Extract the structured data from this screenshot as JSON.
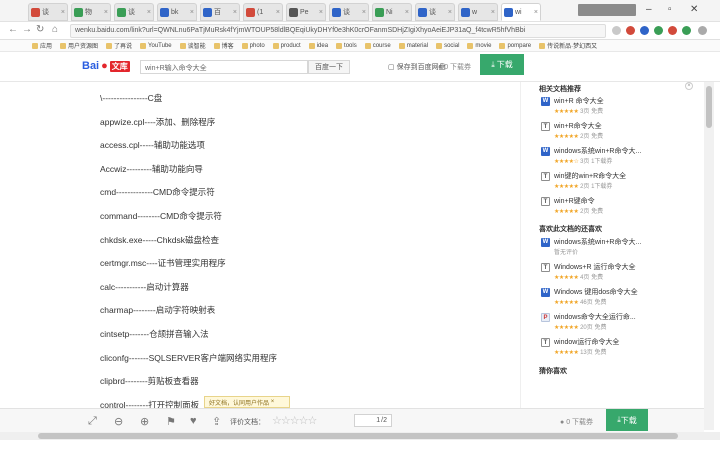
{
  "browser": {
    "tabs": [
      {
        "label": "谈",
        "color": "#d24a3b",
        "active": false
      },
      {
        "label": "物",
        "color": "#3a9e56",
        "active": false
      },
      {
        "label": "谈",
        "color": "#3a9e56",
        "active": false
      },
      {
        "label": "bk",
        "color": "#2f64c8",
        "active": false
      },
      {
        "label": "百",
        "color": "#2f64c8",
        "active": false
      },
      {
        "label": "(1",
        "color": "#d24a3b",
        "active": false
      },
      {
        "label": "Pe",
        "color": "#555555",
        "active": false
      },
      {
        "label": "谈",
        "color": "#2f64c8",
        "active": false
      },
      {
        "label": "Ni",
        "color": "#3a9e56",
        "active": false
      },
      {
        "label": "谈",
        "color": "#2f64c8",
        "active": false
      },
      {
        "label": "w",
        "color": "#2f64c8",
        "active": false
      },
      {
        "label": "wi",
        "color": "#2f64c8",
        "active": true
      }
    ],
    "profile_label": "",
    "url": "wenku.baidu.com/link?url=QWNLnu6PaTjMuRsk4fYjmWTOUP58ldlBQEqiUkyDHYf0e3hK0crOFanmSDHjZIgiXhyoAeiEJP31aQ_f4tcwR5hfVhBbi",
    "bookmarks": [
      {
        "label": "应用"
      },
      {
        "label": "用户资源图"
      },
      {
        "label": "了再说"
      },
      {
        "label": "YouTube"
      },
      {
        "label": "谈智能"
      },
      {
        "label": "博客"
      },
      {
        "label": "photo"
      },
      {
        "label": "product"
      },
      {
        "label": "idea"
      },
      {
        "label": "tools"
      },
      {
        "label": "course"
      },
      {
        "label": "material"
      },
      {
        "label": "social"
      },
      {
        "label": "movie"
      },
      {
        "label": "pompare"
      },
      {
        "label": "传说新品·梦幻西又"
      }
    ]
  },
  "wenku": {
    "logo_text": "Bai",
    "logo_badge": "文库",
    "search_value": "win+R输入命令大全",
    "search_button": "百度一下",
    "save_label": "保存到百度网盘",
    "coins": "0 下载券",
    "download_label": "下载"
  },
  "document": {
    "lines": [
      "\\----------------C盘",
      "appwize.cpl----添加、删除程序",
      "access.cpl-----辅助功能选项",
      "Accwiz---------辅助功能向导",
      "cmd-------------CMD命令提示符",
      "command--------CMD命令提示符",
      "chkdsk.exe-----Chkdsk磁盘检查",
      "certmgr.msc----证书管理实用程序",
      "calc-----------启动计算器",
      "charmap--------启动字符映射表",
      "cintsetp-------仓颉拼音输入法",
      "cliconfg-------SQLSERVER客户端网络实用程序",
      "clipbrd--------剪贴板查看器",
      "control--------打开控制面板"
    ]
  },
  "sidebar": {
    "related_title": "相关文档推荐",
    "related": [
      {
        "icon": "W",
        "kind": "w",
        "title": "win+R 命令大全",
        "stars": "★★★★★",
        "pages": "3页",
        "price": "免费"
      },
      {
        "icon": "T",
        "kind": "t",
        "title": "win+R命令大全",
        "stars": "★★★★★",
        "pages": "2页",
        "price": "免费"
      },
      {
        "icon": "W",
        "kind": "w",
        "title": "windows系统win+R命令大...",
        "stars": "★★★★☆",
        "pages": "3页",
        "price": "1下载券"
      },
      {
        "icon": "T",
        "kind": "t",
        "title": "win键的win+R命令大全",
        "stars": "★★★★★",
        "pages": "2页",
        "price": "1下载券"
      },
      {
        "icon": "T",
        "kind": "t",
        "title": "win+R键命令",
        "stars": "★★★★★",
        "pages": "2页",
        "price": "免费"
      }
    ],
    "liked_title": "喜欢此文档的还喜欢",
    "liked": [
      {
        "icon": "W",
        "kind": "w",
        "title": "windows系统win+R命令大...",
        "stars": "",
        "pages": "",
        "price": "暂无评价"
      },
      {
        "icon": "T",
        "kind": "t",
        "title": "Windows+R 运行命令大全",
        "stars": "★★★★★",
        "pages": "4页",
        "price": "免费"
      },
      {
        "icon": "W",
        "kind": "w",
        "title": "Windows 键用dos命令大全",
        "stars": "★★★★★",
        "pages": "46页",
        "price": "免费"
      },
      {
        "icon": "P",
        "kind": "p",
        "title": "windows命令大全运行命...",
        "stars": "★★★★★",
        "pages": "20页",
        "price": "免费"
      },
      {
        "icon": "T",
        "kind": "t",
        "title": "window运行命令大全",
        "stars": "★★★★★",
        "pages": "13页",
        "price": "免费"
      }
    ],
    "more_title": "猜你喜欢"
  },
  "toolbar": {
    "rate_label": "评价文档：",
    "rate_stars": "☆☆☆☆☆",
    "page_current": "1",
    "page_total": "/2",
    "coins": "0 下载券",
    "download_label": "下载",
    "tooltip": "好文档，认同用户作品"
  },
  "colors": {
    "download_green": "#37a86c",
    "star_orange": "#f1a526",
    "baidu_blue": "#2b5ee0",
    "baidu_red": "#e3262c"
  }
}
